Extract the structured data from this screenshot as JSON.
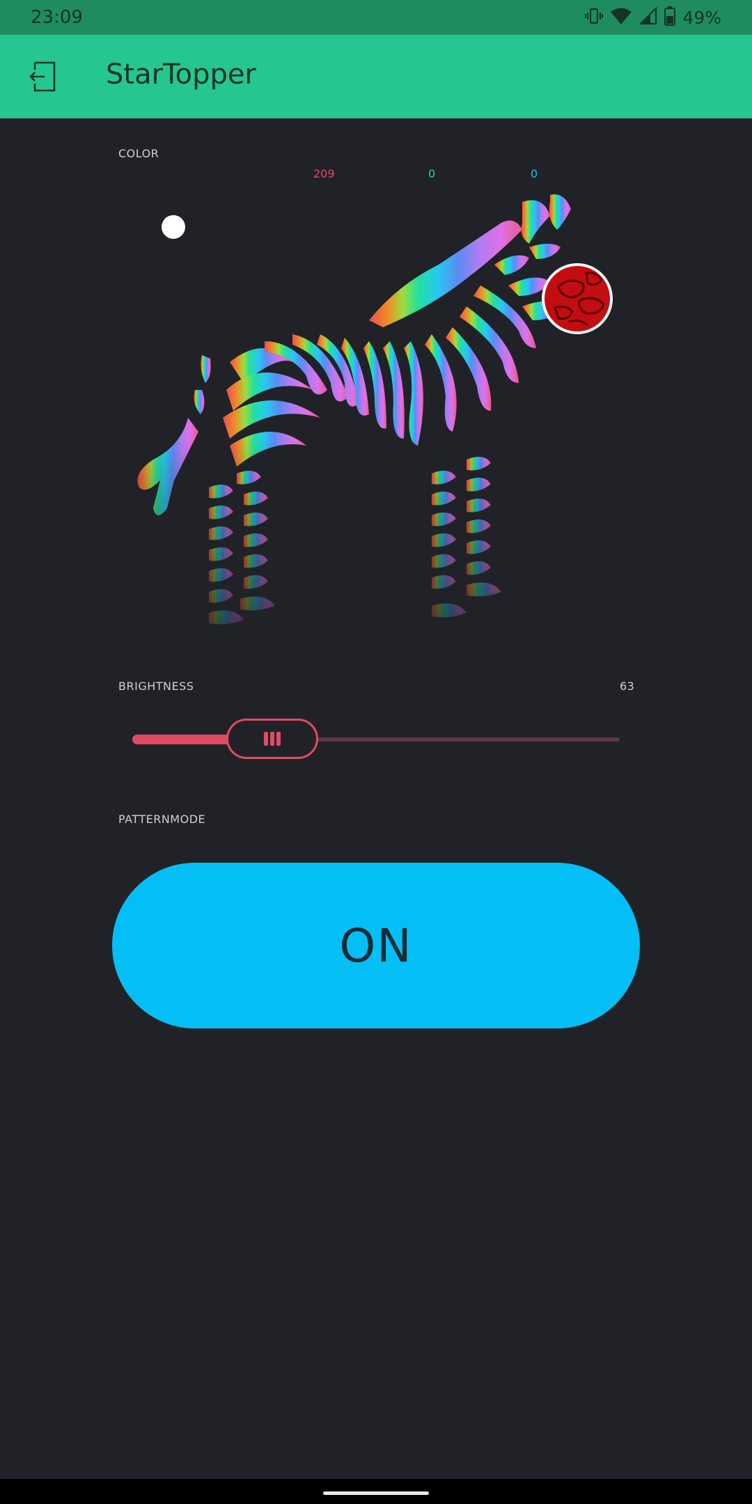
{
  "status_bar": {
    "time": "23:09",
    "battery_percent": "49%",
    "icons": [
      "vibrate-icon",
      "wifi-icon",
      "signal-icon",
      "battery-icon"
    ]
  },
  "app_bar": {
    "title": "StarTopper",
    "back_icon": "exit-icon"
  },
  "color_widget": {
    "label": "COLOR",
    "r": "209",
    "g": "0",
    "b": "0",
    "selected_color": "#c30d10"
  },
  "brightness_widget": {
    "label": "BRIGHTNESS",
    "value": "63",
    "fraction": 0.25,
    "accent": "#e04b64"
  },
  "patternmode_widget": {
    "label": "PATTERNMODE",
    "button_label": "ON",
    "button_color": "#04bff5"
  },
  "colors": {
    "status_bar": "#1f8c5f",
    "app_bar": "#26c690",
    "background": "#212227"
  }
}
